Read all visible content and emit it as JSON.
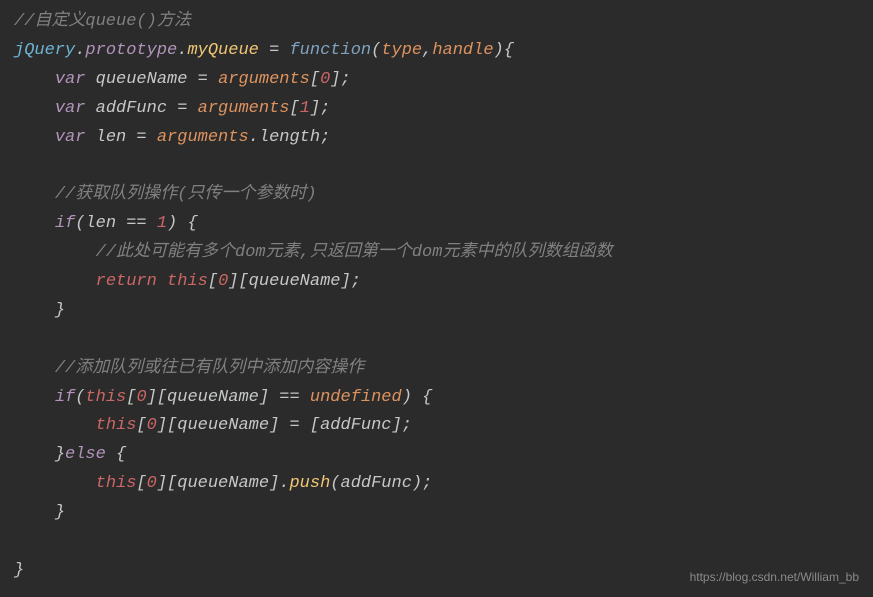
{
  "code": {
    "c1": "//自定义queue()方法",
    "jquery": "jQuery",
    "dot": ".",
    "prototype": "prototype",
    "myqueue": "myQueue",
    "eq": " = ",
    "function": "function",
    "lp": "(",
    "type": "type",
    "comma": ",",
    "handle": "handle",
    "rp": ")",
    "lb": "{",
    "rb": "}",
    "var": "var",
    "queueName": "queueName",
    "arguments": "arguments",
    "lbr": "[",
    "rbr": "]",
    "n0": "0",
    "n1": "1",
    "semi": ";",
    "addFunc": "addFunc",
    "len": "len",
    "length": "length",
    "c2": "//获取队列操作(只传一个参数时)",
    "if": "if",
    "eqeq": " == ",
    "one": "1",
    "c3": "//此处可能有多个dom元素,只返回第一个dom元素中的队列数组函数",
    "return": "return",
    "this": "this",
    "c4": "//添加队列或往已有队列中添加内容操作",
    "undefined": "undefined",
    "else": "else",
    "push": "push",
    "sp": " "
  },
  "watermark": "https://blog.csdn.net/William_bb"
}
